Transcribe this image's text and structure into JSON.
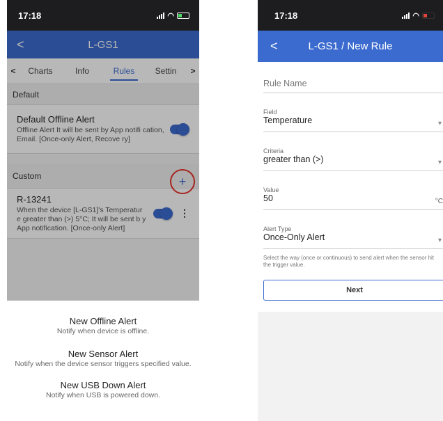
{
  "left": {
    "status": {
      "time": "17:18"
    },
    "nav": {
      "back": "<",
      "title": "L-GS1"
    },
    "tabs": {
      "prev": "<",
      "next": ">",
      "items": [
        "Charts",
        "Info",
        "Rules",
        "Settin"
      ]
    },
    "default_section": {
      "heading": "Default",
      "rule": {
        "title": "Default Offline Alert",
        "desc": "Offline Alert It will be sent by App notifi cation, Email. [Once-only Alert, Recove ry]"
      }
    },
    "custom_section": {
      "heading": "Custom",
      "add": "+",
      "rule": {
        "title": "R-13241",
        "desc": "When the device [L-GS1]'s Temperatur e greater than (>) 5°C; It will be sent b y App notification. [Once-only Alert]"
      }
    },
    "sheet": [
      {
        "title": "New Offline Alert",
        "sub": "Notify when device is offline."
      },
      {
        "title": "New Sensor Alert",
        "sub": "Notify when the device sensor triggers specified value."
      },
      {
        "title": "New USB Down Alert",
        "sub": "Notify when USB is powered down."
      }
    ]
  },
  "right": {
    "status": {
      "time": "17:18"
    },
    "nav": {
      "back": "<",
      "title": "L-GS1 / New Rule"
    },
    "form": {
      "rule_name_placeholder": "Rule Name",
      "field_label": "Field",
      "field_value": "Temperature",
      "criteria_label": "Criteria",
      "criteria_value": "greater than (>)",
      "value_label": "Value",
      "value_value": "50",
      "value_unit": "°C",
      "alert_type_label": "Alert Type",
      "alert_type_value": "Once-Only Alert",
      "hint": "Select the way (once or continuous) to send alert when the sensor hit the trigger value.",
      "next": "Next"
    }
  },
  "colors": {
    "accent": "#3c6bcf",
    "highlight_ring": "#e8332c"
  },
  "icons": [
    "back-chevron-icon",
    "signal-icon",
    "wifi-icon",
    "battery-icon",
    "add-icon",
    "kebab-menu-icon",
    "chevron-down-icon"
  ]
}
